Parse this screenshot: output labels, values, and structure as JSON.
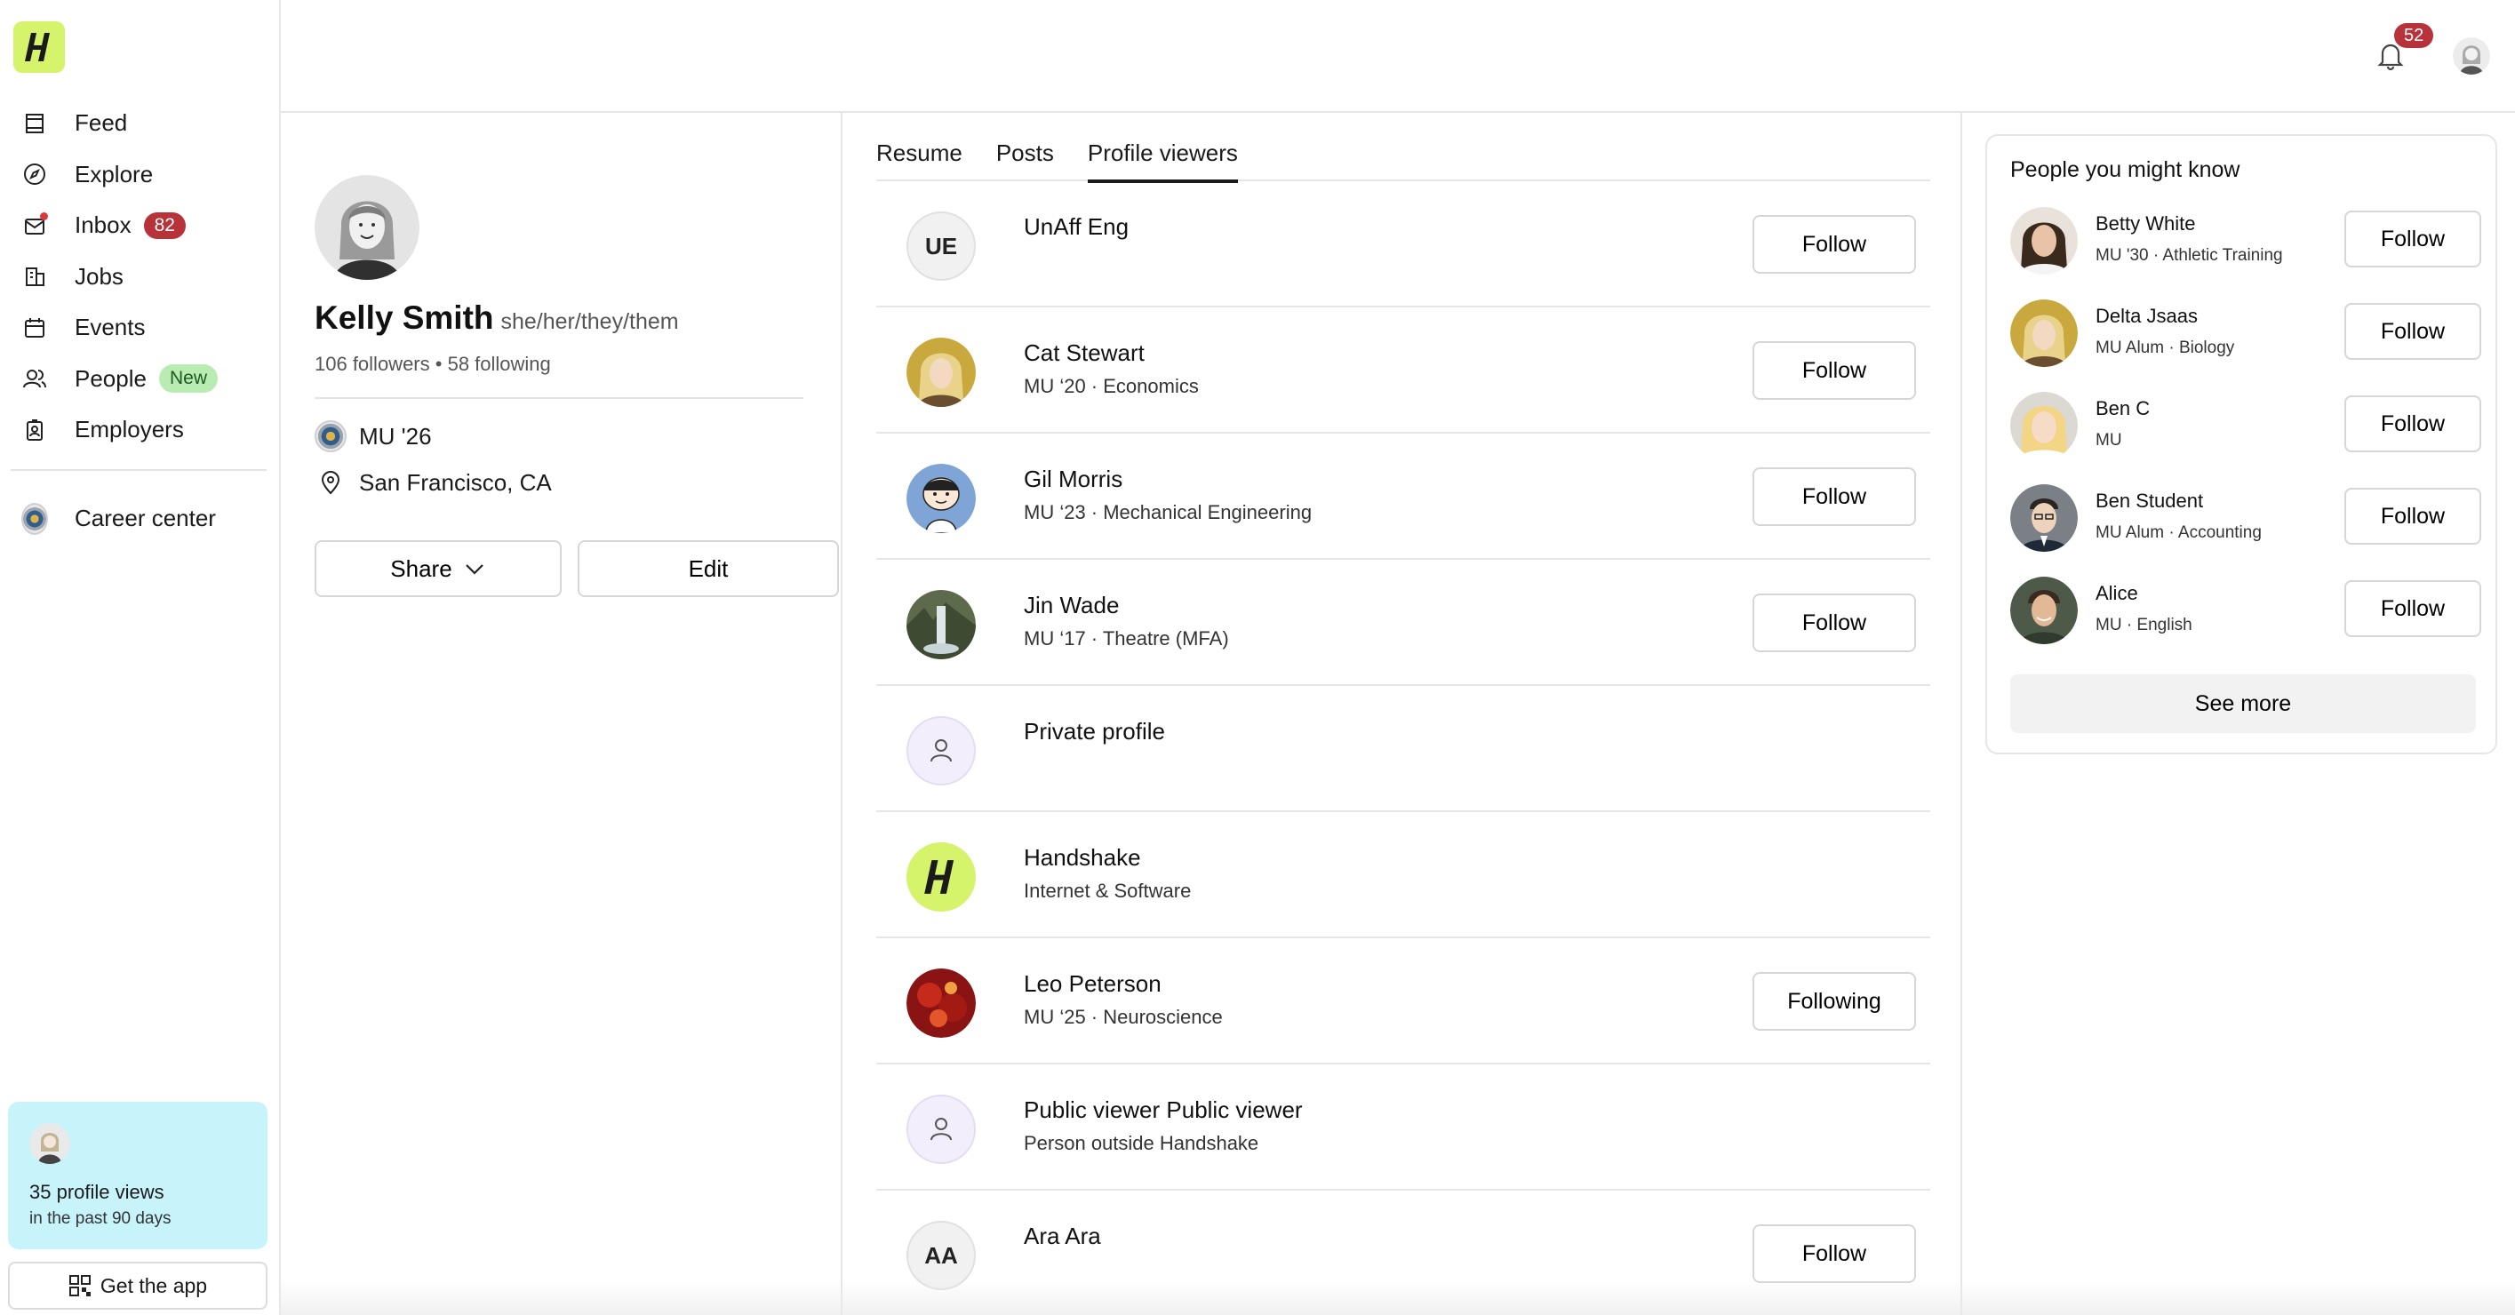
{
  "sidebar": {
    "items": [
      {
        "label": "Feed",
        "icon": "feed-icon"
      },
      {
        "label": "Explore",
        "icon": "compass-icon"
      },
      {
        "label": "Inbox",
        "icon": "inbox-icon",
        "badge": "82"
      },
      {
        "label": "Jobs",
        "icon": "building-icon"
      },
      {
        "label": "Events",
        "icon": "calendar-icon"
      },
      {
        "label": "People",
        "icon": "people-icon",
        "tag": "New"
      },
      {
        "label": "Employers",
        "icon": "employer-badge-icon"
      }
    ],
    "career_center": "Career center",
    "views_card": {
      "count": "35 profile views",
      "period": "in the past 90 days"
    },
    "get_app": "Get the app"
  },
  "topbar": {
    "notification_count": "52"
  },
  "profile": {
    "name": "Kelly Smith",
    "pronouns": "she/her/they/them",
    "followers": "106 followers",
    "following": "58 following",
    "separator": "•",
    "school": "MU '26",
    "location": "San Francisco, CA",
    "share_label": "Share",
    "edit_label": "Edit"
  },
  "tabs": [
    {
      "label": "Resume",
      "active": false
    },
    {
      "label": "Posts",
      "active": false
    },
    {
      "label": "Profile viewers",
      "active": true
    }
  ],
  "viewers": [
    {
      "name": "UnAff Eng",
      "subtitle": "",
      "avatar": "initials",
      "initials": "UE",
      "button": "Follow"
    },
    {
      "name": "Cat Stewart",
      "subtitle": "MU ‘20 · Economics",
      "avatar": "photo-blonde",
      "button": "Follow"
    },
    {
      "name": "Gil Morris",
      "subtitle": "MU ‘23 · Mechanical Engineering",
      "avatar": "photo-cartoon",
      "button": "Follow"
    },
    {
      "name": "Jin Wade",
      "subtitle": "MU ‘17 · Theatre (MFA)",
      "avatar": "photo-waterfall",
      "button": "Follow"
    },
    {
      "name": "Private profile",
      "subtitle": "",
      "avatar": "private",
      "button": ""
    },
    {
      "name": "Handshake",
      "subtitle": "Internet & Software",
      "avatar": "handshake",
      "button": ""
    },
    {
      "name": "Leo Peterson",
      "subtitle": "MU ‘25 · Neuroscience",
      "avatar": "photo-red",
      "button": "Following"
    },
    {
      "name": "Public viewer Public viewer",
      "subtitle": "Person outside Handshake",
      "avatar": "private",
      "button": ""
    },
    {
      "name": "Ara Ara",
      "subtitle": "",
      "avatar": "initials",
      "initials": "AA",
      "button": "Follow"
    }
  ],
  "people": {
    "title": "People you might know",
    "list": [
      {
        "name": "Betty White",
        "subtitle": "MU '30 · Athletic Training",
        "button": "Follow"
      },
      {
        "name": "Delta Jsaas",
        "subtitle": "MU Alum · Biology",
        "button": "Follow"
      },
      {
        "name": "Ben C",
        "subtitle": "MU",
        "button": "Follow"
      },
      {
        "name": "Ben Student",
        "subtitle": "MU Alum · Accounting",
        "button": "Follow"
      },
      {
        "name": "Alice",
        "subtitle": "MU · English",
        "button": "Follow"
      }
    ],
    "see_more": "See more"
  },
  "colors": {
    "brand": "#d5f36b",
    "badge_red": "#b8323a",
    "new_green": "#b9ecb2",
    "views_card": "#c7f3fb"
  }
}
